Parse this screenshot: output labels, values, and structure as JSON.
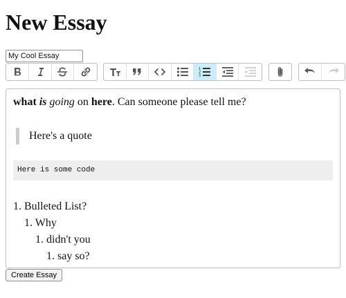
{
  "page": {
    "heading": "New Essay"
  },
  "form": {
    "title_value": "My Cool Essay",
    "submit_label": "Create Essay"
  },
  "toolbar": {
    "text_group": [
      "bold-icon",
      "italic-icon",
      "strikethrough-icon",
      "link-icon"
    ],
    "block_group": [
      "heading-icon",
      "quote-icon",
      "code-icon",
      "bullet-list-icon",
      "numbered-list-icon",
      "decrease-indent-icon",
      "increase-indent-icon"
    ],
    "file_group": [
      "attach-files-icon"
    ],
    "history_group": [
      "undo-icon",
      "redo-icon"
    ],
    "active_button": "numbered-list-icon",
    "active_color": "#cbeefa"
  },
  "editor": {
    "p1": {
      "b1": "what",
      "bi": "is",
      "i1": "going",
      "t1": "on",
      "b2": "here",
      "t2": ". Can someone please tell me?"
    },
    "quote": "Here's a quote",
    "code": "Here is some code",
    "list": [
      {
        "marker": "1.",
        "text": "Bulleted List?"
      },
      {
        "marker": "1.",
        "text": "Why"
      },
      {
        "marker": "1.",
        "text": "didn't you"
      },
      {
        "marker": "1.",
        "text": "say so?"
      }
    ]
  }
}
